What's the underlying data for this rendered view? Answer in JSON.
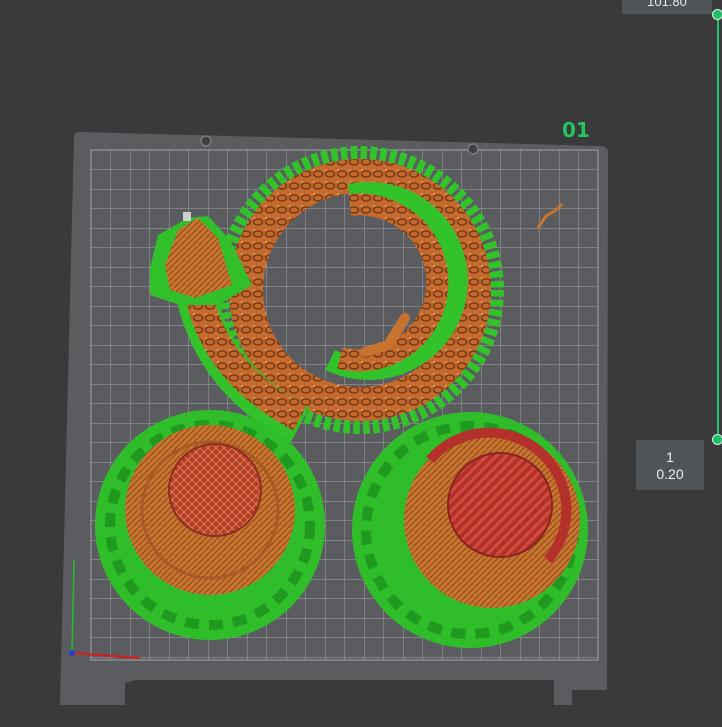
{
  "plate": {
    "label": "01"
  },
  "layer_slider": {
    "top_value": "101.80",
    "bottom_layer": "1",
    "bottom_height": "0.20"
  },
  "colors": {
    "background": "#3a3a3d",
    "plate": "#5b5c5f",
    "grid": "#9a9ca0",
    "model": "#c86a2a",
    "support": "#2fbe2a",
    "top_surface": "#b8302a",
    "accent": "#1fbf6a"
  },
  "icons": {
    "origin_axes": "xyz-axis-icon"
  }
}
